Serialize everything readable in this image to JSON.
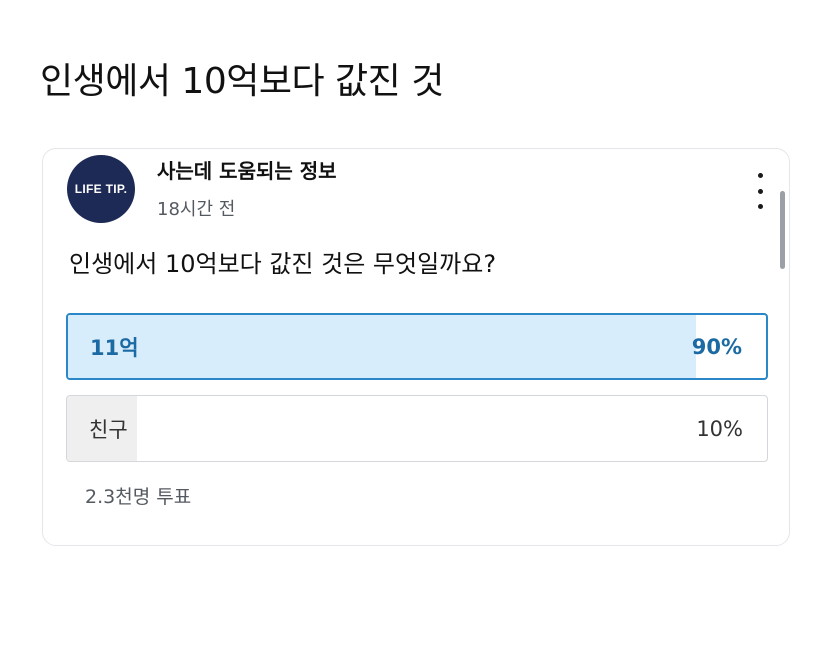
{
  "page": {
    "title": "인생에서 10억보다 값진 것"
  },
  "post": {
    "avatar_text": "LIFE TIP.",
    "author": "사는데 도움되는 정보",
    "time": "18시간 전",
    "question": "인생에서 10억보다 값진 것은 무엇일까요?",
    "more_icon": "more-vertical-icon"
  },
  "poll": {
    "options": [
      {
        "label": "11억",
        "percent_text": "90%",
        "percent": 90,
        "selected": true
      },
      {
        "label": "친구",
        "percent_text": "10%",
        "percent": 10,
        "selected": false
      }
    ],
    "vote_count": "2.3천명 투표"
  },
  "colors": {
    "accent": "#2b87c8",
    "selected_fill": "#d7edfb",
    "selected_text": "#1b6aa3",
    "unselected_fill": "#efefef",
    "avatar_bg": "#1d2a55"
  }
}
